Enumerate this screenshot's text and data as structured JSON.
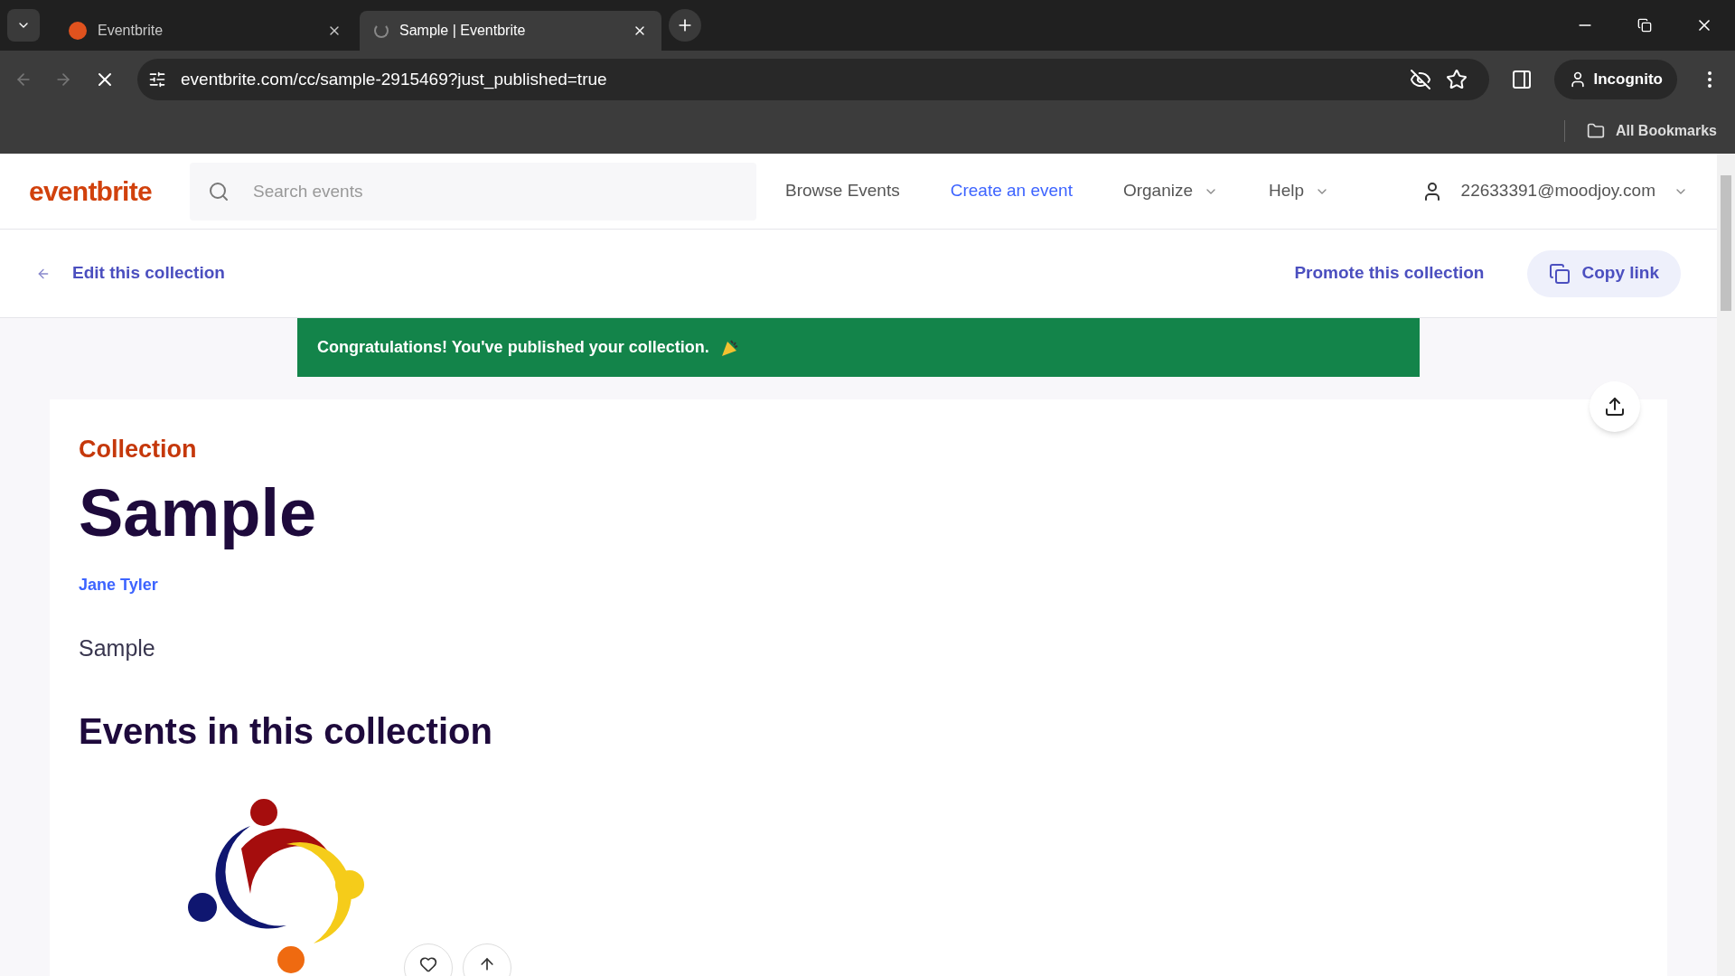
{
  "browser": {
    "tabs": [
      {
        "title": "Eventbrite",
        "selected": false
      },
      {
        "title": "Sample | Eventbrite",
        "selected": true
      }
    ],
    "url": "eventbrite.com/cc/sample-2915469?just_published=true",
    "profile": "Incognito",
    "bookmarks_label": "All Bookmarks"
  },
  "header": {
    "logo": "eventbrite",
    "search": {
      "placeholder": "Search events"
    },
    "nav": [
      {
        "label": "Browse Events",
        "kind": "link"
      },
      {
        "label": "Create an event",
        "kind": "accent"
      },
      {
        "label": "Organize",
        "kind": "menu"
      },
      {
        "label": "Help",
        "kind": "menu"
      }
    ],
    "account": "22633391@moodjoy.com"
  },
  "toolbar": {
    "back_link": "Edit this collection",
    "promote_link": "Promote this collection",
    "copy_button": "Copy link"
  },
  "banner": "Congratulations! You've published your collection.",
  "collection": {
    "eyebrow": "Collection",
    "title": "Sample",
    "author": "Jane Tyler",
    "description": "Sample",
    "events_heading": "Events in this collection"
  }
}
